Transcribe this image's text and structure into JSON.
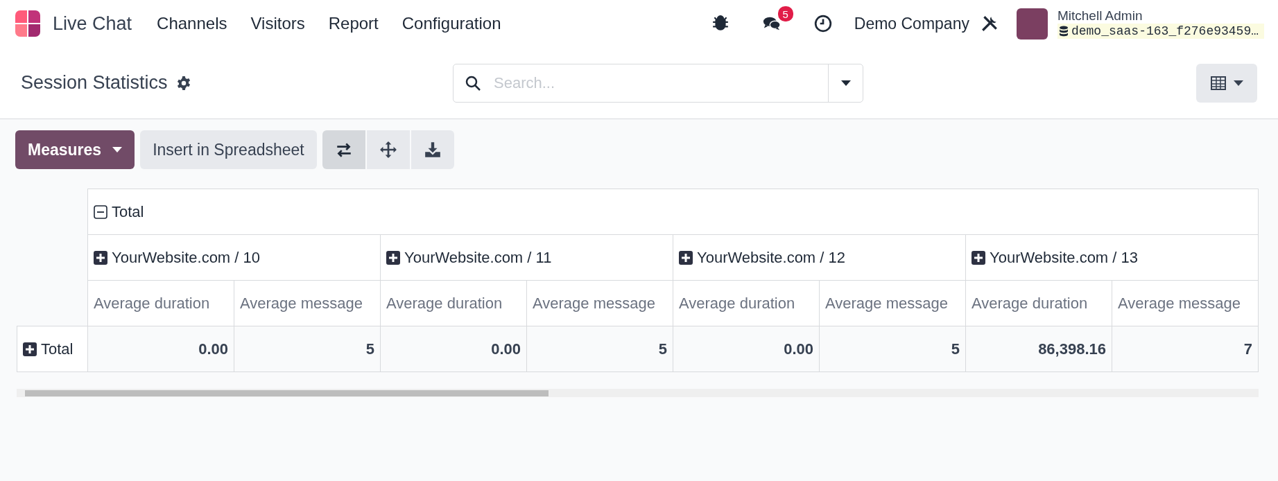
{
  "navbar": {
    "app_name": "Live Chat",
    "menu": [
      "Channels",
      "Visitors",
      "Report",
      "Configuration"
    ],
    "notification_count": "5",
    "company": "Demo Company",
    "user": {
      "name": "Mitchell Admin",
      "database": "demo_saas-163_f276e93459…"
    }
  },
  "control_panel": {
    "title": "Session Statistics",
    "search": {
      "placeholder": "Search..."
    }
  },
  "toolbar": {
    "measures": "Measures",
    "insert": "Insert in Spreadsheet",
    "tools": [
      {
        "kind": "flip",
        "selected": true
      },
      {
        "kind": "expand",
        "selected": false
      },
      {
        "kind": "download",
        "selected": false
      }
    ]
  },
  "pivot": {
    "header": {
      "label": "Total",
      "expanded": true,
      "children": [
        {
          "label": "YourWebsite.com / 10",
          "expanded": false,
          "measures": [
            "Average duration",
            "Average message"
          ]
        },
        {
          "label": "YourWebsite.com / 11",
          "expanded": false,
          "measures": [
            "Average duration",
            "Average message"
          ]
        },
        {
          "label": "YourWebsite.com / 12",
          "expanded": false,
          "measures": [
            "Average duration",
            "Average message"
          ]
        },
        {
          "label": "YourWebsite.com / 13",
          "expanded": false,
          "measures": [
            "Average duration",
            "Average message"
          ]
        }
      ]
    },
    "rows": [
      {
        "label": "Total",
        "expanded": false,
        "cells": [
          "0.00",
          "5",
          "0.00",
          "5",
          "0.00",
          "5",
          "86,398.16",
          "7"
        ]
      }
    ]
  }
}
